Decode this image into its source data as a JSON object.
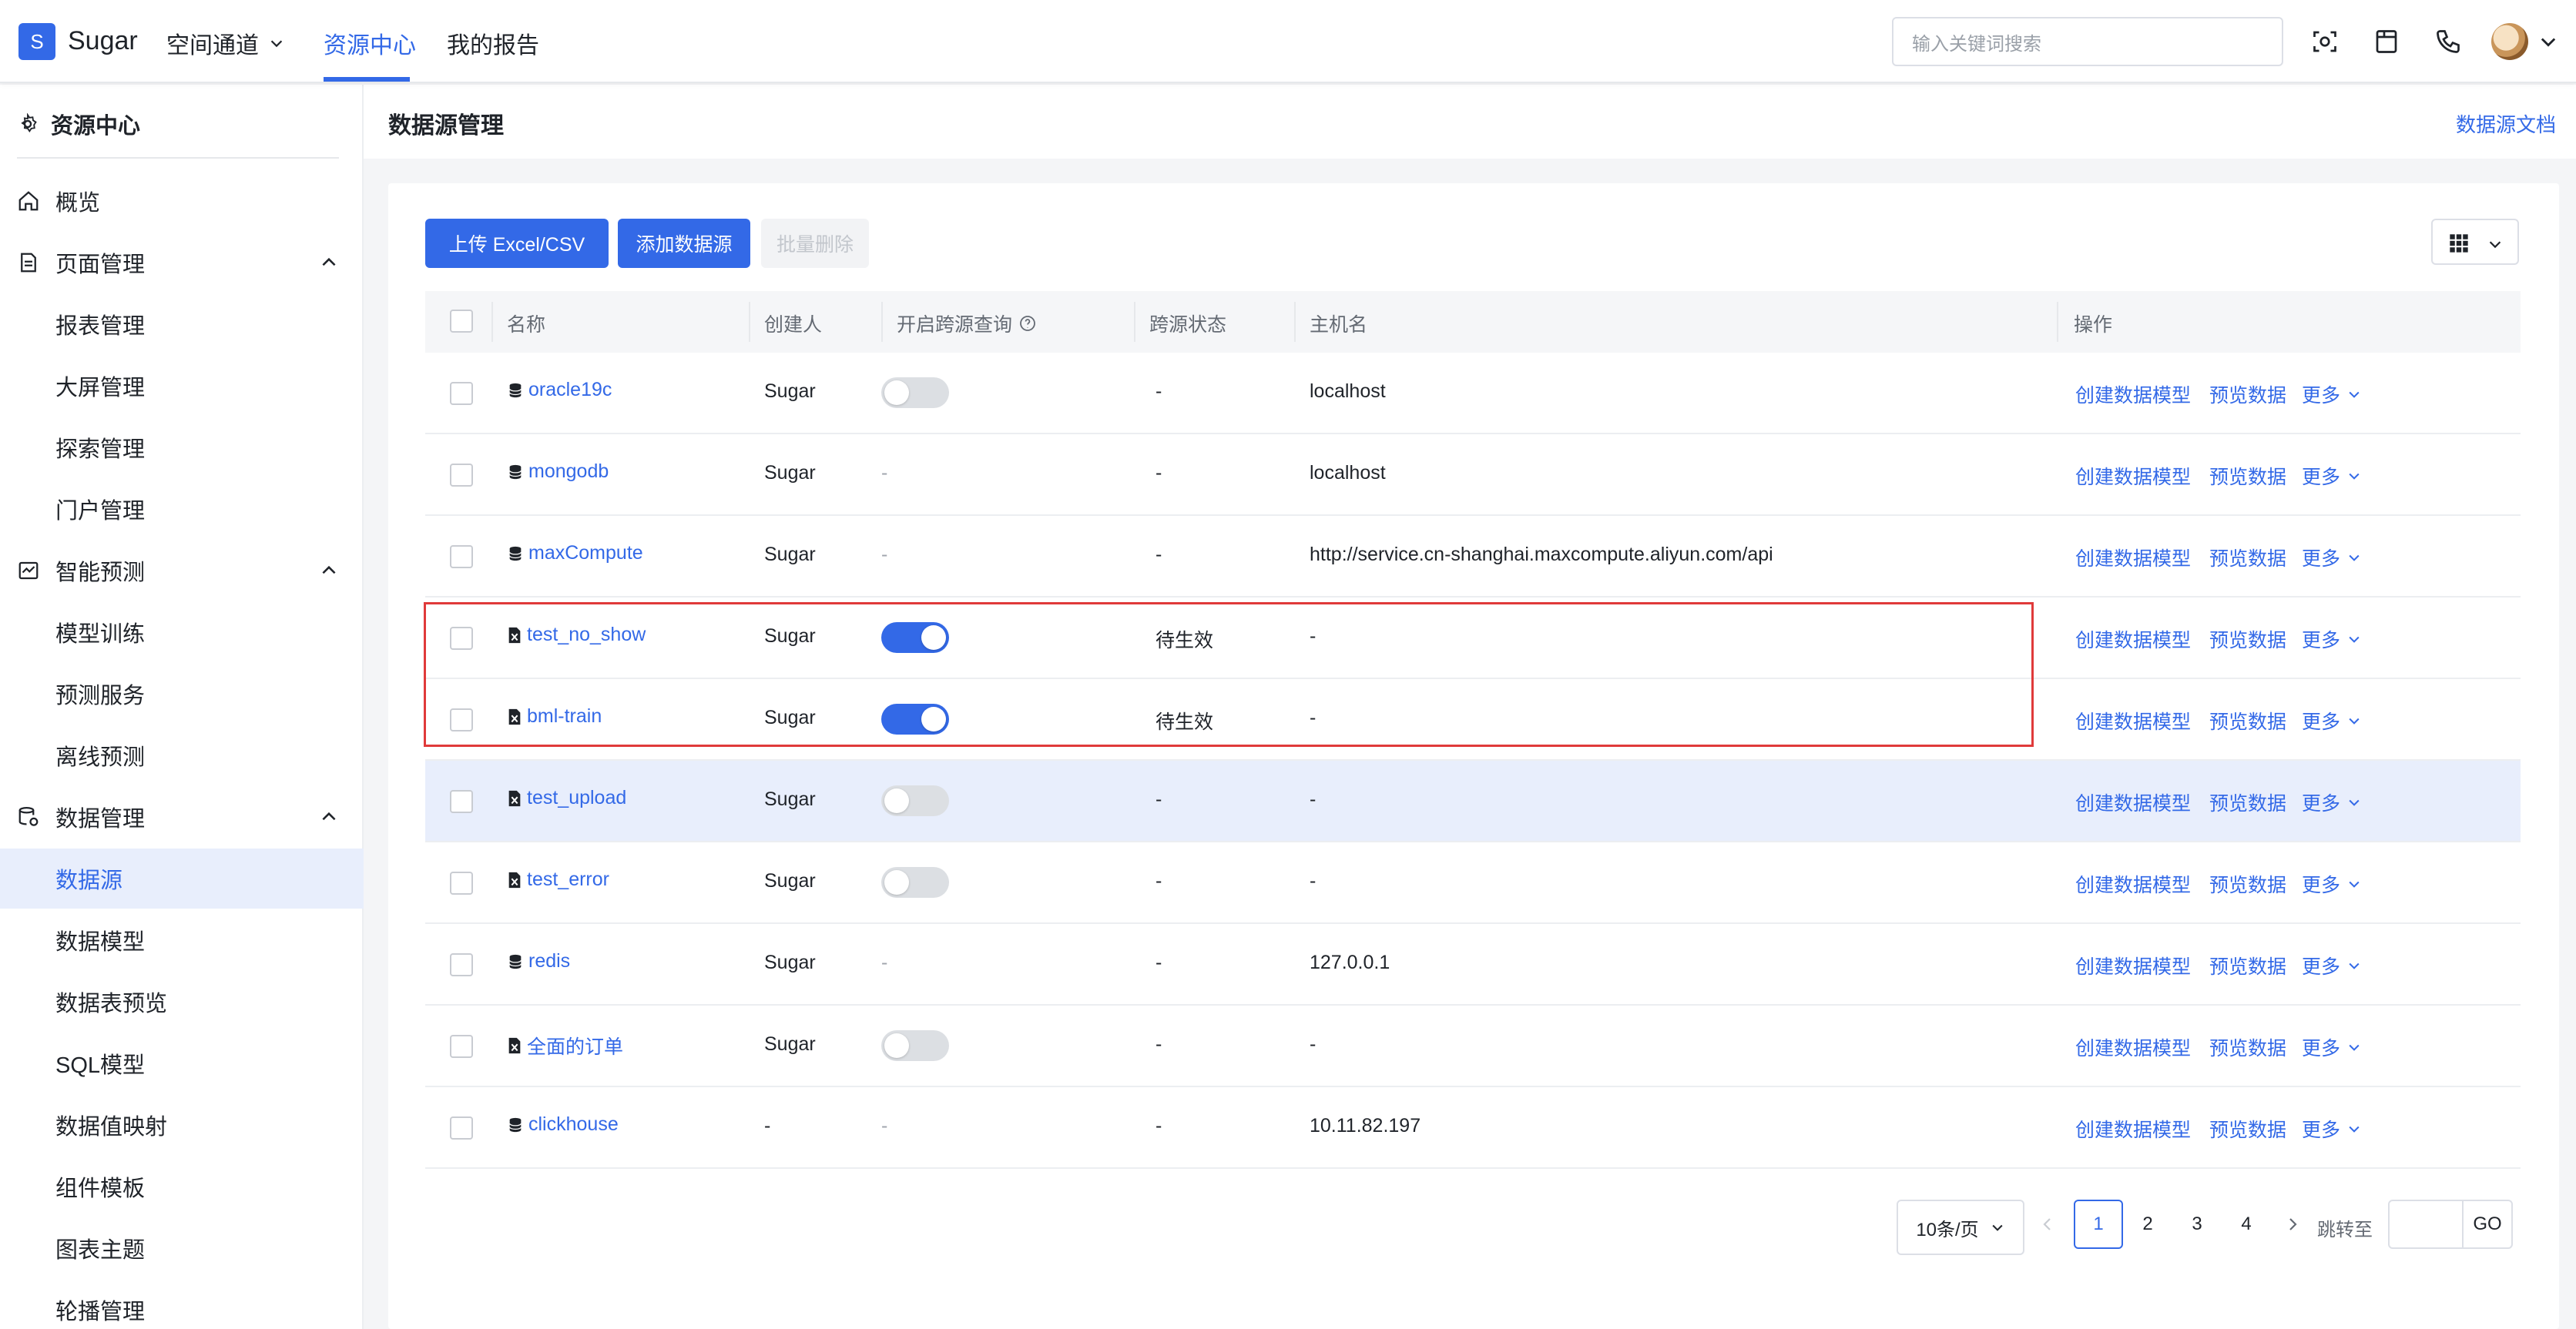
{
  "app": {
    "logo_letter": "S",
    "name": "Sugar"
  },
  "topnav": {
    "space": "空间通道",
    "resource_center": "资源中心",
    "my_reports": "我的报告",
    "search_placeholder": "输入关键词搜索"
  },
  "sidebar": {
    "header": "资源中心",
    "items": [
      {
        "label": "概览"
      },
      {
        "label": "页面管理"
      },
      {
        "label": "报表管理"
      },
      {
        "label": "大屏管理"
      },
      {
        "label": "探索管理"
      },
      {
        "label": "门户管理"
      },
      {
        "label": "智能预测"
      },
      {
        "label": "模型训练"
      },
      {
        "label": "预测服务"
      },
      {
        "label": "离线预测"
      },
      {
        "label": "数据管理"
      },
      {
        "label": "数据源"
      },
      {
        "label": "数据模型"
      },
      {
        "label": "数据表预览"
      },
      {
        "label": "SQL模型"
      },
      {
        "label": "数据值映射"
      },
      {
        "label": "组件模板"
      },
      {
        "label": "图表主题"
      },
      {
        "label": "轮播管理"
      }
    ]
  },
  "page": {
    "title": "数据源管理",
    "doc_link": "数据源文档"
  },
  "toolbar": {
    "upload": "上传 Excel/CSV",
    "add": "添加数据源",
    "batch_delete": "批量删除"
  },
  "table": {
    "headers": {
      "name": "名称",
      "creator": "创建人",
      "cross_query": "开启跨源查询",
      "cross_status": "跨源状态",
      "host": "主机名",
      "ops": "操作"
    },
    "actions": {
      "create_model": "创建数据模型",
      "preview": "预览数据",
      "more": "更多"
    },
    "rows": [
      {
        "name": "oracle19c",
        "icon": "database-icon",
        "creator": "Sugar",
        "toggle": "off",
        "status": "-",
        "host": "localhost"
      },
      {
        "name": "mongodb",
        "icon": "database-icon",
        "creator": "Sugar",
        "toggle": "-",
        "status": "-",
        "host": "localhost"
      },
      {
        "name": "maxCompute",
        "icon": "database-icon",
        "creator": "Sugar",
        "toggle": "-",
        "status": "-",
        "host": "http://service.cn-shanghai.maxcompute.aliyun.com/api"
      },
      {
        "name": "test_no_show",
        "icon": "excel-file-icon",
        "creator": "Sugar",
        "toggle": "on",
        "status": "待生效",
        "host": "-"
      },
      {
        "name": "bml-train",
        "icon": "excel-file-icon",
        "creator": "Sugar",
        "toggle": "on",
        "status": "待生效",
        "host": "-"
      },
      {
        "name": "test_upload",
        "icon": "excel-file-icon",
        "creator": "Sugar",
        "toggle": "off",
        "status": "-",
        "host": "-"
      },
      {
        "name": "test_error",
        "icon": "excel-file-icon",
        "creator": "Sugar",
        "toggle": "off",
        "status": "-",
        "host": "-"
      },
      {
        "name": "redis",
        "icon": "database-icon",
        "creator": "Sugar",
        "toggle": "-",
        "status": "-",
        "host": "127.0.0.1"
      },
      {
        "name": "全面的订单",
        "icon": "excel-file-icon",
        "creator": "Sugar",
        "toggle": "off",
        "status": "-",
        "host": "-"
      },
      {
        "name": "clickhouse",
        "icon": "database-icon",
        "creator": "-",
        "toggle": "-",
        "status": "-",
        "host": "10.11.82.197"
      }
    ]
  },
  "pagination": {
    "page_size": "10条/页",
    "pages": [
      "1",
      "2",
      "3",
      "4"
    ],
    "current": "1",
    "goto_label": "跳转至",
    "go": "GO"
  },
  "colors": {
    "accent": "#3369e7",
    "highlight_border": "#e03a3a",
    "hover_row": "#e8eefc"
  }
}
